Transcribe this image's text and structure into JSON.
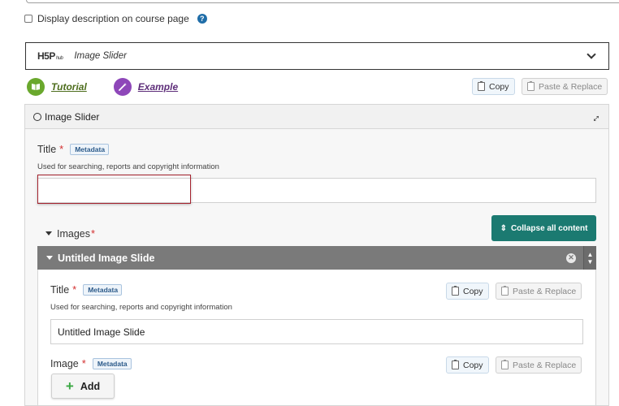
{
  "description_checkbox": {
    "label": "Display description on course page",
    "checked": false,
    "help_glyph": "?"
  },
  "hub": {
    "logo": "H5P",
    "logo_sub": "hub",
    "content_type": "Image Slider"
  },
  "links": {
    "tutorial": "Tutorial",
    "example": "Example"
  },
  "actions": {
    "copy": "Copy",
    "paste": "Paste & Replace"
  },
  "editor": {
    "header": "Image Slider",
    "title_field": {
      "label": "Title",
      "required": "*",
      "metadata": "Metadata",
      "description": "Used for searching, reports and copyright information",
      "value": ""
    },
    "images": {
      "label": "Images",
      "required": "*",
      "collapse_label": "Collapse all content",
      "slide": {
        "header": "Untitled Image Slide",
        "title_field": {
          "label": "Title",
          "required": "*",
          "metadata": "Metadata",
          "description": "Used for searching, reports and copyright information",
          "value": "Untitled Image Slide"
        },
        "image_field": {
          "label": "Image",
          "required": "*",
          "metadata": "Metadata",
          "add": "Add"
        }
      }
    }
  }
}
